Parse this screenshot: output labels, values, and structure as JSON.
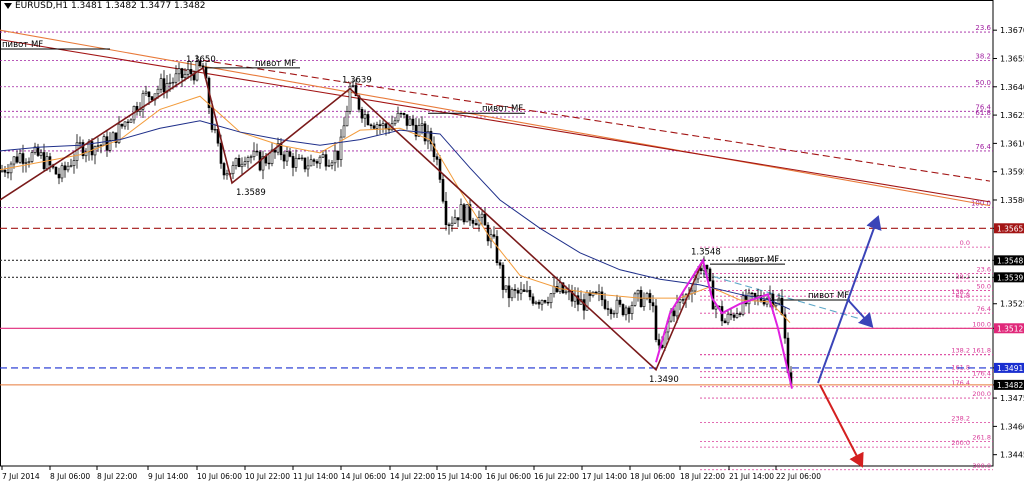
{
  "chart_data": {
    "type": "candlestick",
    "title": "EURUSD,H1  1.3481 1.3482 1.3477 1.3482",
    "symbol": "EURUSD",
    "timeframe": "H1",
    "ohlc_header": [
      1.3481,
      1.3482,
      1.3477,
      1.3482
    ],
    "ylim": [
      1.3439,
      1.3686
    ],
    "y_ticks": [
      "1.3670",
      "1.3655",
      "1.3640",
      "1.3625",
      "1.3610",
      "1.3595",
      "1.3580",
      "1.3565",
      "1.3548",
      "1.3539",
      "1.3525",
      "1.3512",
      "1.3491",
      "1.3482",
      "1.3475",
      "1.3460",
      "1.3445"
    ],
    "x_ticks": [
      "7 Jul 2014",
      "8 Jul 06:00",
      "8 Jul 22:00",
      "9 Jul 14:00",
      "10 Jul 06:00",
      "10 Jul 22:00",
      "11 Jul 14:00",
      "14 Jul 06:00",
      "14 Jul 22:00",
      "15 Jul 14:00",
      "16 Jul 06:00",
      "16 Jul 22:00",
      "17 Jul 14:00",
      "18 Jul 06:00",
      "18 Jul 22:00",
      "21 Jul 14:00",
      "22 Jul 06:00"
    ],
    "grid": false,
    "price_path": [
      [
        0,
        1.3595
      ],
      [
        20,
        1.3604
      ],
      [
        40,
        1.3603
      ],
      [
        60,
        1.3592
      ],
      [
        80,
        1.3608
      ],
      [
        110,
        1.361
      ],
      [
        140,
        1.3633
      ],
      [
        160,
        1.364
      ],
      [
        180,
        1.3645
      ],
      [
        203,
        1.365
      ],
      [
        212,
        1.362
      ],
      [
        222,
        1.3598
      ],
      [
        232,
        1.3595
      ],
      [
        245,
        1.3605
      ],
      [
        260,
        1.36
      ],
      [
        280,
        1.3606
      ],
      [
        300,
        1.3598
      ],
      [
        320,
        1.3602
      ],
      [
        340,
        1.3605
      ],
      [
        350,
        1.3639
      ],
      [
        365,
        1.3625
      ],
      [
        385,
        1.3618
      ],
      [
        400,
        1.3624
      ],
      [
        418,
        1.3618
      ],
      [
        432,
        1.361
      ],
      [
        440,
        1.3595
      ],
      [
        447,
        1.3568
      ],
      [
        460,
        1.3574
      ],
      [
        480,
        1.357
      ],
      [
        495,
        1.3555
      ],
      [
        505,
        1.353
      ],
      [
        520,
        1.353
      ],
      [
        540,
        1.3528
      ],
      [
        560,
        1.3532
      ],
      [
        580,
        1.3525
      ],
      [
        600,
        1.3528
      ],
      [
        620,
        1.3522
      ],
      [
        640,
        1.3528
      ],
      [
        652,
        1.3525
      ],
      [
        660,
        1.3495
      ],
      [
        670,
        1.352
      ],
      [
        685,
        1.3528
      ],
      [
        703,
        1.3548
      ],
      [
        712,
        1.3528
      ],
      [
        725,
        1.3515
      ],
      [
        740,
        1.3524
      ],
      [
        760,
        1.3528
      ],
      [
        770,
        1.353
      ],
      [
        780,
        1.3526
      ],
      [
        790,
        1.3485
      ]
    ],
    "moving_averages": [
      {
        "name": "",
        "color": "#f39c3c",
        "points": [
          [
            0,
            1.3596
          ],
          [
            40,
            1.36
          ],
          [
            80,
            1.3604
          ],
          [
            120,
            1.3612
          ],
          [
            160,
            1.3628
          ],
          [
            200,
            1.3635
          ],
          [
            240,
            1.3616
          ],
          [
            280,
            1.3609
          ],
          [
            320,
            1.3605
          ],
          [
            360,
            1.3617
          ],
          [
            400,
            1.3618
          ],
          [
            430,
            1.3612
          ],
          [
            460,
            1.3585
          ],
          [
            490,
            1.356
          ],
          [
            520,
            1.354
          ],
          [
            560,
            1.3533
          ],
          [
            600,
            1.353
          ],
          [
            640,
            1.3528
          ],
          [
            680,
            1.3528
          ],
          [
            710,
            1.3534
          ],
          [
            740,
            1.3527
          ],
          [
            770,
            1.3526
          ],
          [
            790,
            1.3515
          ]
        ]
      },
      {
        "name": "",
        "color": "#1f2f8a",
        "points": [
          [
            0,
            1.3606
          ],
          [
            40,
            1.3608
          ],
          [
            80,
            1.3609
          ],
          [
            120,
            1.3612
          ],
          [
            160,
            1.3618
          ],
          [
            200,
            1.3622
          ],
          [
            240,
            1.3616
          ],
          [
            280,
            1.3612
          ],
          [
            320,
            1.3609
          ],
          [
            360,
            1.3612
          ],
          [
            400,
            1.3617
          ],
          [
            440,
            1.3615
          ],
          [
            470,
            1.3597
          ],
          [
            500,
            1.358
          ],
          [
            540,
            1.3565
          ],
          [
            580,
            1.3552
          ],
          [
            620,
            1.3543
          ],
          [
            660,
            1.3538
          ],
          [
            700,
            1.3535
          ],
          [
            740,
            1.353
          ],
          [
            770,
            1.3527
          ],
          [
            790,
            1.3522
          ]
        ]
      }
    ],
    "horizontal_levels": [
      {
        "price": 1.3565,
        "color": "#a31515",
        "style": "dash",
        "label": "1.3565",
        "tag_bg": "#a31515"
      },
      {
        "price": 1.3548,
        "color": "#333333",
        "style": "dot",
        "label": "1.3548",
        "tag_bg": "#000000"
      },
      {
        "price": 1.3539,
        "color": "#333333",
        "style": "dot",
        "label": "1.3539",
        "tag_bg": "#000000"
      },
      {
        "price": 1.3512,
        "color": "#e0287a",
        "style": "solid",
        "label": "1.3512",
        "tag_bg": "#e0287a"
      },
      {
        "price": 1.3491,
        "color": "#1a2fd0",
        "style": "dash",
        "label": "1.3491",
        "tag_bg": "#1a2fd0"
      },
      {
        "price": 1.3482,
        "color": "#e87a3a",
        "style": "solid",
        "label": "1.3482",
        "tag_bg": "#000000"
      }
    ],
    "fib_levels_left": [
      {
        "price": 1.3669,
        "label": "23.6"
      },
      {
        "price": 1.3654,
        "label": "38.2"
      },
      {
        "price": 1.364,
        "label": "50.0"
      },
      {
        "price": 1.3627,
        "label": "76.4"
      },
      {
        "price": 1.3624,
        "label": "61.8"
      },
      {
        "price": 1.3606,
        "label": "76.4"
      },
      {
        "price": 1.3576,
        "label": "100.0"
      }
    ],
    "fib_levels_right": [
      {
        "price": 1.3555,
        "label": "0.0"
      },
      {
        "price": 1.3541,
        "label": "23.6"
      },
      {
        "price": 1.3537,
        "label": "38.2"
      },
      {
        "price": 1.3532,
        "label": "50.0"
      },
      {
        "price": 1.3527,
        "label": "61.8"
      },
      {
        "price": 1.352,
        "label": "76.4"
      },
      {
        "price": 1.3529,
        "label": "138.2"
      },
      {
        "price": 1.3512,
        "label": "100.0"
      },
      {
        "price": 1.3498,
        "label": "138.2"
      },
      {
        "price": 1.3498,
        "label": "161.8"
      },
      {
        "price": 1.3489,
        "label": "161.8"
      },
      {
        "price": 1.3486,
        "label": "176.4"
      },
      {
        "price": 1.3481,
        "label": "176.4"
      },
      {
        "price": 1.3475,
        "label": "200.0"
      },
      {
        "price": 1.3462,
        "label": "238.2"
      },
      {
        "price": 1.3452,
        "label": "261.8"
      },
      {
        "price": 1.3449,
        "label": "200.0"
      },
      {
        "price": 1.3437,
        "label": "300.0"
      }
    ],
    "zigzag_dark": [
      [
        0,
        1.358
      ],
      [
        203,
        1.365
      ],
      [
        232,
        1.3589
      ],
      [
        350,
        1.3639
      ],
      [
        656,
        1.349
      ],
      [
        703,
        1.3548
      ]
    ],
    "zigzag_magenta": [
      [
        656,
        1.3494
      ],
      [
        670,
        1.352
      ],
      [
        685,
        1.3533
      ],
      [
        703,
        1.3548
      ],
      [
        712,
        1.3528
      ],
      [
        722,
        1.352
      ],
      [
        740,
        1.3525
      ],
      [
        768,
        1.353
      ],
      [
        778,
        1.3512
      ],
      [
        792,
        1.348
      ]
    ],
    "trend_lines": [
      {
        "color": "#e87a3a",
        "style": "solid",
        "from": [
          0,
          1.367
        ],
        "to": [
          990,
          1.3577
        ]
      },
      {
        "color": "#a31515",
        "style": "solid",
        "from": [
          0,
          1.3665
        ],
        "to": [
          990,
          1.3579
        ]
      },
      {
        "color": "#a31515",
        "style": "dash",
        "from": [
          203,
          1.3654
        ],
        "to": [
          990,
          1.359
        ]
      },
      {
        "color": "#5fa8c8",
        "style": "dash",
        "from": [
          703,
          1.3541
        ],
        "to": [
          860,
          1.3517
        ]
      }
    ],
    "pivot_segments": [
      {
        "y": 1.366,
        "x1": 0,
        "x2": 110,
        "label": "пивот MF",
        "label_x": 2
      },
      {
        "y": 1.365,
        "x1": 205,
        "x2": 300,
        "label": "пивот MF",
        "label_x": 255
      },
      {
        "y": 1.3626,
        "x1": 428,
        "x2": 525,
        "label": "пивот MF",
        "label_x": 482
      },
      {
        "y": 1.3546,
        "x1": 710,
        "x2": 785,
        "label": "пивот MF",
        "label_x": 738
      },
      {
        "y": 1.3527,
        "x1": 770,
        "x2": 850,
        "label": "пивот MF",
        "label_x": 808
      }
    ],
    "point_labels": [
      {
        "x": 186,
        "y": 1.365,
        "text": "1.3650"
      },
      {
        "x": 342,
        "y": 1.3639,
        "text": "1.3639"
      },
      {
        "x": 236,
        "y": 1.3589,
        "text": "1.3589"
      },
      {
        "x": 691,
        "y": 1.3548,
        "text": "1.3548"
      },
      {
        "x": 649,
        "y": 1.349,
        "text": "1.3490"
      }
    ],
    "arrows": [
      {
        "color": "#3a44b8",
        "points": [
          [
            818,
            1.3483
          ],
          [
            848,
            1.3527
          ],
          [
            872,
            1.3513
          ]
        ]
      },
      {
        "color": "#3a44b8",
        "points": [
          [
            848,
            1.3527
          ],
          [
            878,
            1.3571
          ]
        ]
      },
      {
        "color": "#d42020",
        "points": [
          [
            820,
            1.3482
          ],
          [
            862,
            1.3439
          ]
        ]
      }
    ]
  }
}
